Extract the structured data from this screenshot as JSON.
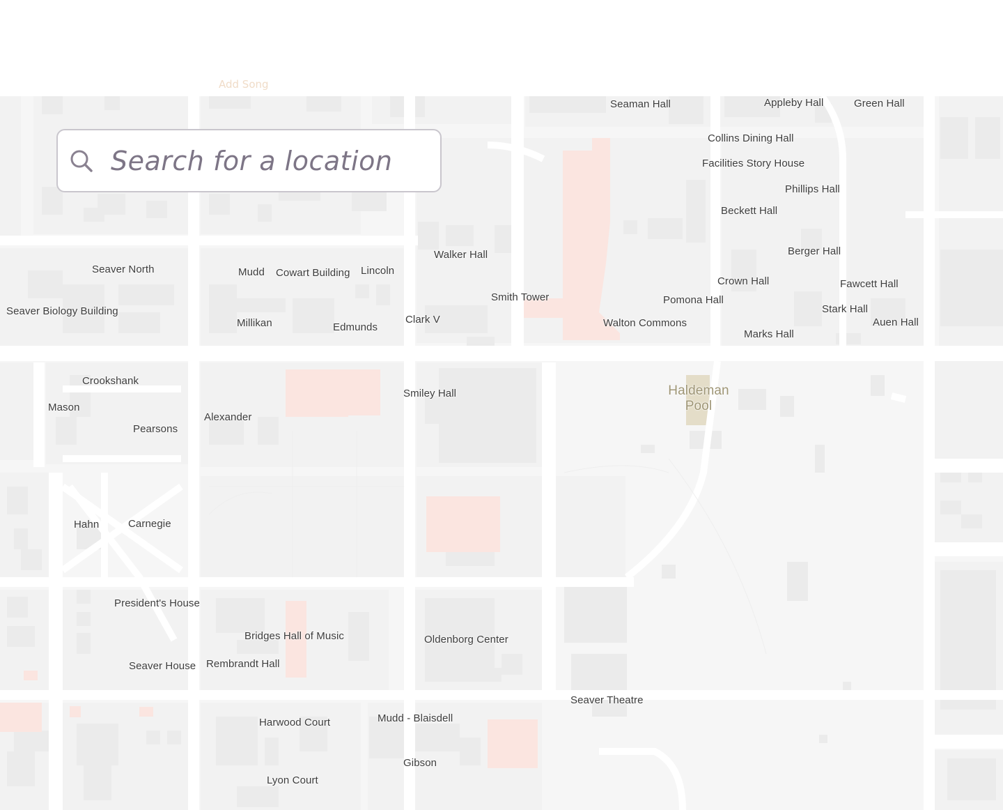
{
  "header": {
    "add_song_label": "Add Song"
  },
  "search": {
    "placeholder": "Search for a location",
    "value": ""
  },
  "map": {
    "labels": {
      "seaman_hall": "Seaman Hall",
      "appleby_hall": "Appleby Hall",
      "green_hall": "Green Hall",
      "collins_dining_hall": "Collins Dining Hall",
      "facilities_story_house": "Facilities Story House",
      "phillips_hall": "Phillips Hall",
      "beckett_hall": "Beckett Hall",
      "berger_hall": "Berger Hall",
      "crown_hall": "Crown Hall",
      "fawcett_hall": "Fawcett Hall",
      "pomona_hall": "Pomona Hall",
      "stark_hall": "Stark Hall",
      "auen_hall": "Auen Hall",
      "walton_commons": "Walton Commons",
      "marks_hall": "Marks Hall",
      "walker_hall": "Walker Hall",
      "smith_tower": "Smith Tower",
      "clark_v": "Clark V",
      "seaver_north": "Seaver North",
      "mudd": "Mudd",
      "cowart_building": "Cowart Building",
      "lincoln": "Lincoln",
      "seaver_biology_building": "Seaver Biology Building",
      "millikan": "Millikan",
      "edmunds": "Edmunds",
      "crookshank": "Crookshank",
      "mason": "Mason",
      "pearsons": "Pearsons",
      "alexander": "Alexander",
      "smiley_hall": "Smiley Hall",
      "haldeman_pool": "Haldeman Pool",
      "hahn": "Hahn",
      "carnegie": "Carnegie",
      "presidents_house": "President's House",
      "bridges_hall_of_music": "Bridges Hall of Music",
      "oldenborg_center": "Oldenborg Center",
      "seaver_house": "Seaver House",
      "rembrandt_hall": "Rembrandt Hall",
      "seaver_theatre": "Seaver Theatre",
      "harwood_court": "Harwood Court",
      "mudd_blaisdell": "Mudd - Blaisdell",
      "gibson": "Gibson",
      "lyon_court": "Lyon Court"
    }
  },
  "colors": {
    "map_background": "#f6f6f6",
    "road": "#ffffff",
    "building": "#ebebeb",
    "highlight_building": "#fbe5e0",
    "pool": "#e4ddc8",
    "label_text": "#3c3c3c",
    "search_border": "#c9c6cd",
    "add_song_text": "#f0dcc8"
  }
}
